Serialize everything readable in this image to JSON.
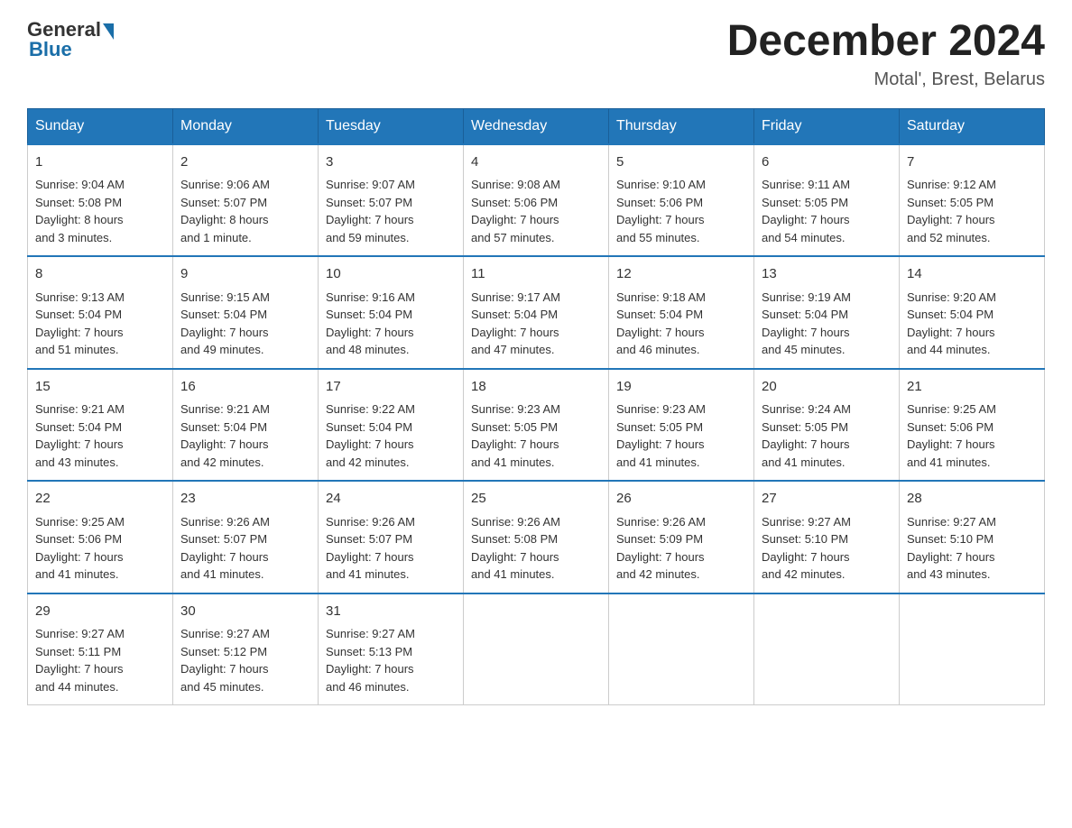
{
  "logo": {
    "general": "General",
    "blue": "Blue"
  },
  "header": {
    "title": "December 2024",
    "location": "Motal', Brest, Belarus"
  },
  "days_of_week": [
    "Sunday",
    "Monday",
    "Tuesday",
    "Wednesday",
    "Thursday",
    "Friday",
    "Saturday"
  ],
  "weeks": [
    [
      {
        "day": "1",
        "info": "Sunrise: 9:04 AM\nSunset: 5:08 PM\nDaylight: 8 hours\nand 3 minutes."
      },
      {
        "day": "2",
        "info": "Sunrise: 9:06 AM\nSunset: 5:07 PM\nDaylight: 8 hours\nand 1 minute."
      },
      {
        "day": "3",
        "info": "Sunrise: 9:07 AM\nSunset: 5:07 PM\nDaylight: 7 hours\nand 59 minutes."
      },
      {
        "day": "4",
        "info": "Sunrise: 9:08 AM\nSunset: 5:06 PM\nDaylight: 7 hours\nand 57 minutes."
      },
      {
        "day": "5",
        "info": "Sunrise: 9:10 AM\nSunset: 5:06 PM\nDaylight: 7 hours\nand 55 minutes."
      },
      {
        "day": "6",
        "info": "Sunrise: 9:11 AM\nSunset: 5:05 PM\nDaylight: 7 hours\nand 54 minutes."
      },
      {
        "day": "7",
        "info": "Sunrise: 9:12 AM\nSunset: 5:05 PM\nDaylight: 7 hours\nand 52 minutes."
      }
    ],
    [
      {
        "day": "8",
        "info": "Sunrise: 9:13 AM\nSunset: 5:04 PM\nDaylight: 7 hours\nand 51 minutes."
      },
      {
        "day": "9",
        "info": "Sunrise: 9:15 AM\nSunset: 5:04 PM\nDaylight: 7 hours\nand 49 minutes."
      },
      {
        "day": "10",
        "info": "Sunrise: 9:16 AM\nSunset: 5:04 PM\nDaylight: 7 hours\nand 48 minutes."
      },
      {
        "day": "11",
        "info": "Sunrise: 9:17 AM\nSunset: 5:04 PM\nDaylight: 7 hours\nand 47 minutes."
      },
      {
        "day": "12",
        "info": "Sunrise: 9:18 AM\nSunset: 5:04 PM\nDaylight: 7 hours\nand 46 minutes."
      },
      {
        "day": "13",
        "info": "Sunrise: 9:19 AM\nSunset: 5:04 PM\nDaylight: 7 hours\nand 45 minutes."
      },
      {
        "day": "14",
        "info": "Sunrise: 9:20 AM\nSunset: 5:04 PM\nDaylight: 7 hours\nand 44 minutes."
      }
    ],
    [
      {
        "day": "15",
        "info": "Sunrise: 9:21 AM\nSunset: 5:04 PM\nDaylight: 7 hours\nand 43 minutes."
      },
      {
        "day": "16",
        "info": "Sunrise: 9:21 AM\nSunset: 5:04 PM\nDaylight: 7 hours\nand 42 minutes."
      },
      {
        "day": "17",
        "info": "Sunrise: 9:22 AM\nSunset: 5:04 PM\nDaylight: 7 hours\nand 42 minutes."
      },
      {
        "day": "18",
        "info": "Sunrise: 9:23 AM\nSunset: 5:05 PM\nDaylight: 7 hours\nand 41 minutes."
      },
      {
        "day": "19",
        "info": "Sunrise: 9:23 AM\nSunset: 5:05 PM\nDaylight: 7 hours\nand 41 minutes."
      },
      {
        "day": "20",
        "info": "Sunrise: 9:24 AM\nSunset: 5:05 PM\nDaylight: 7 hours\nand 41 minutes."
      },
      {
        "day": "21",
        "info": "Sunrise: 9:25 AM\nSunset: 5:06 PM\nDaylight: 7 hours\nand 41 minutes."
      }
    ],
    [
      {
        "day": "22",
        "info": "Sunrise: 9:25 AM\nSunset: 5:06 PM\nDaylight: 7 hours\nand 41 minutes."
      },
      {
        "day": "23",
        "info": "Sunrise: 9:26 AM\nSunset: 5:07 PM\nDaylight: 7 hours\nand 41 minutes."
      },
      {
        "day": "24",
        "info": "Sunrise: 9:26 AM\nSunset: 5:07 PM\nDaylight: 7 hours\nand 41 minutes."
      },
      {
        "day": "25",
        "info": "Sunrise: 9:26 AM\nSunset: 5:08 PM\nDaylight: 7 hours\nand 41 minutes."
      },
      {
        "day": "26",
        "info": "Sunrise: 9:26 AM\nSunset: 5:09 PM\nDaylight: 7 hours\nand 42 minutes."
      },
      {
        "day": "27",
        "info": "Sunrise: 9:27 AM\nSunset: 5:10 PM\nDaylight: 7 hours\nand 42 minutes."
      },
      {
        "day": "28",
        "info": "Sunrise: 9:27 AM\nSunset: 5:10 PM\nDaylight: 7 hours\nand 43 minutes."
      }
    ],
    [
      {
        "day": "29",
        "info": "Sunrise: 9:27 AM\nSunset: 5:11 PM\nDaylight: 7 hours\nand 44 minutes."
      },
      {
        "day": "30",
        "info": "Sunrise: 9:27 AM\nSunset: 5:12 PM\nDaylight: 7 hours\nand 45 minutes."
      },
      {
        "day": "31",
        "info": "Sunrise: 9:27 AM\nSunset: 5:13 PM\nDaylight: 7 hours\nand 46 minutes."
      },
      {
        "day": "",
        "info": ""
      },
      {
        "day": "",
        "info": ""
      },
      {
        "day": "",
        "info": ""
      },
      {
        "day": "",
        "info": ""
      }
    ]
  ]
}
